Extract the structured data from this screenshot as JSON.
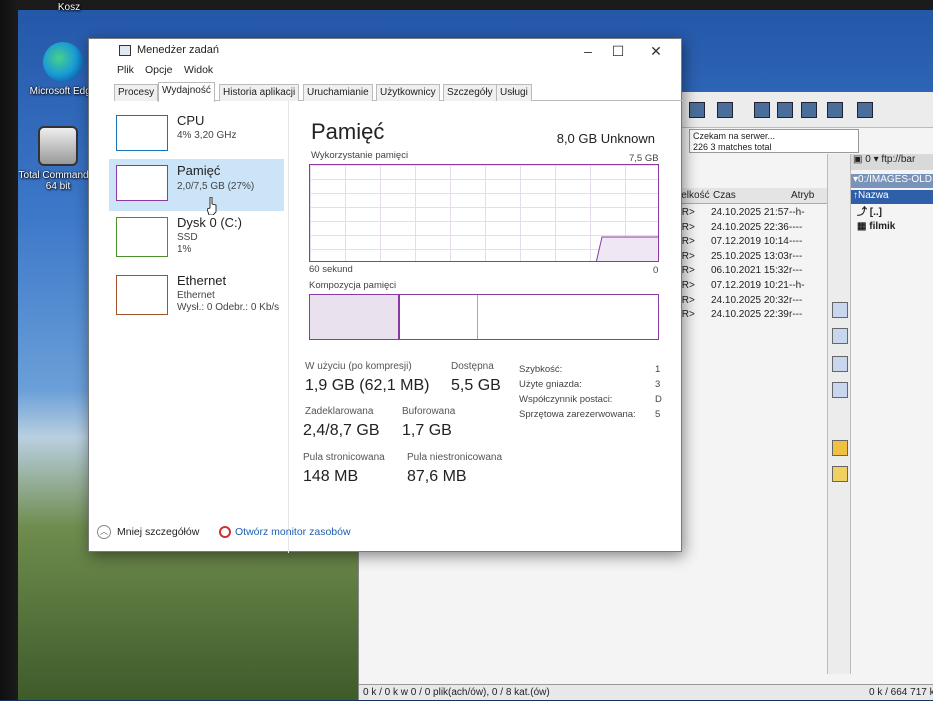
{
  "desktop": {
    "icons": [
      {
        "label": "Kosz"
      },
      {
        "label": "Microsoft Edge"
      },
      {
        "label": "Total Commander 64 bit"
      }
    ]
  },
  "total_commander": {
    "status_lines": [
      "Czekam na serwer...",
      "226 3 matches total"
    ],
    "columns": [
      "ielkość",
      "Czas",
      "Atryb"
    ],
    "rows": [
      {
        "size": "IR>",
        "time": "24.10.2025 21:57",
        "attr": "--h-"
      },
      {
        "size": "IR>",
        "time": "24.10.2025 22:36",
        "attr": "----"
      },
      {
        "size": "IR>",
        "time": "07.12.2019 10:14",
        "attr": "----"
      },
      {
        "size": "IR>",
        "time": "25.10.2025 13:03",
        "attr": "r---"
      },
      {
        "size": "IR>",
        "time": "06.10.2021 15:32",
        "attr": "r---"
      },
      {
        "size": "IR>",
        "time": "07.12.2019 10:21",
        "attr": "--h-"
      },
      {
        "size": "IR>",
        "time": "24.10.2025 20:32",
        "attr": "r---"
      },
      {
        "size": "IR>",
        "time": "24.10.2025 22:39",
        "attr": "r---"
      }
    ],
    "right_panel": {
      "drive": "0",
      "ftp": "ftp://bar",
      "path": "0:/IMAGES-OLD",
      "col": "Nazwa",
      "items": [
        "[..]",
        "filmik"
      ]
    },
    "footer_left": "0 k / 0 k w 0 / 0 plik(ach/ów), 0 / 8 kat.(ów)",
    "footer_right": "0 k / 664 717 k"
  },
  "task_manager": {
    "title": "Menedżer zadań",
    "menu": [
      "Plik",
      "Opcje",
      "Widok"
    ],
    "tabs": [
      "Procesy",
      "Wydajność",
      "Historia aplikacji",
      "Uruchamianie",
      "Użytkownicy",
      "Szczegóły",
      "Usługi"
    ],
    "active_tab": "Wydajność",
    "sidebar": [
      {
        "name": "CPU",
        "sub1": "4% 3,20 GHz",
        "sub2": ""
      },
      {
        "name": "Pamięć",
        "sub1": "2,0/7,5 GB (27%)",
        "sub2": ""
      },
      {
        "name": "Dysk 0 (C:)",
        "sub1": "SSD",
        "sub2": "1%"
      },
      {
        "name": "Ethernet",
        "sub1": "Ethernet",
        "sub2": "Wysł.: 0 Odebr.: 0 Kb/s"
      }
    ],
    "main": {
      "title": "Pamięć",
      "capacity": "8,0 GB Unknown",
      "usage_label": "Wykorzystanie pamięci",
      "usage_max": "7,5 GB",
      "time_left": "60 sekund",
      "time_right": "0",
      "composition_label": "Kompozycja pamięci",
      "stats": {
        "in_use_label": "W użyciu (po kompresji)",
        "in_use": "1,9 GB (62,1 MB)",
        "available_label": "Dostępna",
        "available": "5,5 GB",
        "committed_label": "Zadeklarowana",
        "committed": "2,4/8,7 GB",
        "cached_label": "Buforowana",
        "cached": "1,7 GB",
        "paged_label": "Pula stronicowana",
        "paged": "148 MB",
        "nonpaged_label": "Pula niestronicowana",
        "nonpaged": "87,6 MB"
      },
      "info": [
        {
          "label": "Szybkość:",
          "value": "1"
        },
        {
          "label": "Użyte gniazda:",
          "value": "3"
        },
        {
          "label": "Współczynnik postaci:",
          "value": "D"
        },
        {
          "label": "Sprzętowa zarezerwowana:",
          "value": "5"
        }
      ]
    },
    "footer": {
      "fewer": "Mniej szczegółów",
      "monitor": "Otwórz monitor zasobów"
    },
    "colors": {
      "accent": "#8b3aa5",
      "cpu": "#1a73b8",
      "disk": "#4b8f29",
      "ethernet": "#a0522d",
      "selected": "#cce4f7"
    }
  }
}
